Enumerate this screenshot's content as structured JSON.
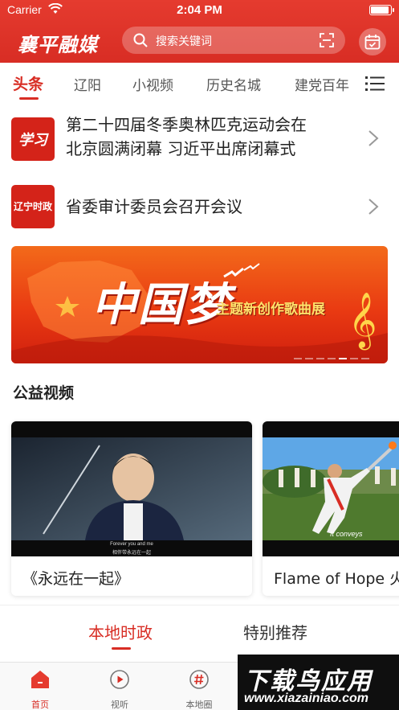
{
  "status_bar": {
    "carrier": "Carrier",
    "time": "2:04 PM"
  },
  "header": {
    "logo": "襄平融媒",
    "search_placeholder": "搜索关键词",
    "search_icon": "search-icon",
    "scan_icon": "scan-icon",
    "calendar_icon": "calendar-check-icon",
    "accent_color": "#d82d24"
  },
  "tabs": {
    "items": [
      "头条",
      "辽阳",
      "小视频",
      "历史名城",
      "建党百年"
    ],
    "active": "头条",
    "menu_icon": "list-menu-icon"
  },
  "headlines": [
    {
      "badge": "学习",
      "title_line1": "第二十四届冬季奥林匹克运动会在",
      "title_line2": "北京圆满闭幕 习近平出席闭幕式"
    },
    {
      "badge": "辽宁时政",
      "title_line1": "省委审计委员会召开会议",
      "title_line2": ""
    }
  ],
  "banner": {
    "headline": "中国梦",
    "subtitle": "主题新创作歌曲展",
    "page_count": 8,
    "active_page": 5
  },
  "section": {
    "title": "公益视频"
  },
  "videos": [
    {
      "caption": "《永远在一起》",
      "subtitle_en": "Forever you and me",
      "subtitle_cn": "相伴带永远在一起"
    },
    {
      "caption": "Flame of Hope 火",
      "subtitle_en": "It conveys",
      "subtitle_cn": ""
    }
  ],
  "subtabs": {
    "items": [
      "本地时政",
      "特别推荐"
    ],
    "active": "本地时政"
  },
  "tabbar": {
    "items": [
      {
        "label": "首页",
        "icon": "home-icon"
      },
      {
        "label": "视听",
        "icon": "play-icon"
      },
      {
        "label": "本地圈",
        "icon": "hashtag-icon"
      }
    ],
    "active": "首页"
  },
  "watermark": {
    "line1": "下载鸟应用",
    "line2": "www.xiazainiao.com"
  }
}
